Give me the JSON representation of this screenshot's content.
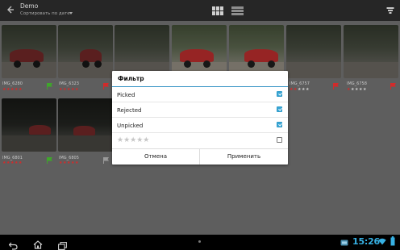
{
  "actionbar": {
    "title": "Demo",
    "subtitle": "Сортировать по дате"
  },
  "photos": [
    {
      "name": "IMG_6280",
      "rating": 5,
      "flag": "picked"
    },
    {
      "name": "IMG_6323",
      "rating": 5,
      "flag": "rejected"
    },
    {
      "name": "",
      "rating": 0,
      "flag": "none"
    },
    {
      "name": "",
      "rating": 0,
      "flag": "none"
    },
    {
      "name": "",
      "rating": 0,
      "flag": "none"
    },
    {
      "name": "IMG_6757",
      "rating": 2,
      "flag": "rejected"
    },
    {
      "name": "IMG_6758",
      "rating": 1,
      "flag": "rejected"
    },
    {
      "name": "IMG_6801",
      "rating": 5,
      "flag": "picked"
    },
    {
      "name": "IMG_6805",
      "rating": 5,
      "flag": "unpicked"
    }
  ],
  "dialog": {
    "title": "Фильтр",
    "options": [
      {
        "label": "Picked",
        "checked": true
      },
      {
        "label": "Rejected",
        "checked": true
      },
      {
        "label": "Unpicked",
        "checked": true
      }
    ],
    "rating_stars": "★★★★★",
    "rating_checked": false,
    "cancel_label": "Отмена",
    "apply_label": "Применить"
  },
  "statusbar": {
    "time": "15:26"
  },
  "colors": {
    "accent": "#37b1e4",
    "picked_flag": "#3fa62b",
    "rejected_flag": "#d22b2b",
    "unpicked_flag": "#9a9a9a",
    "star_on": "#d22b2b"
  },
  "icons": [
    "back-arrow-icon",
    "grid-view-icon",
    "list-view-icon",
    "filter-icon",
    "nav-back-icon",
    "nav-home-icon",
    "nav-recent-apps-icon",
    "wifi-icon",
    "battery-icon"
  ]
}
